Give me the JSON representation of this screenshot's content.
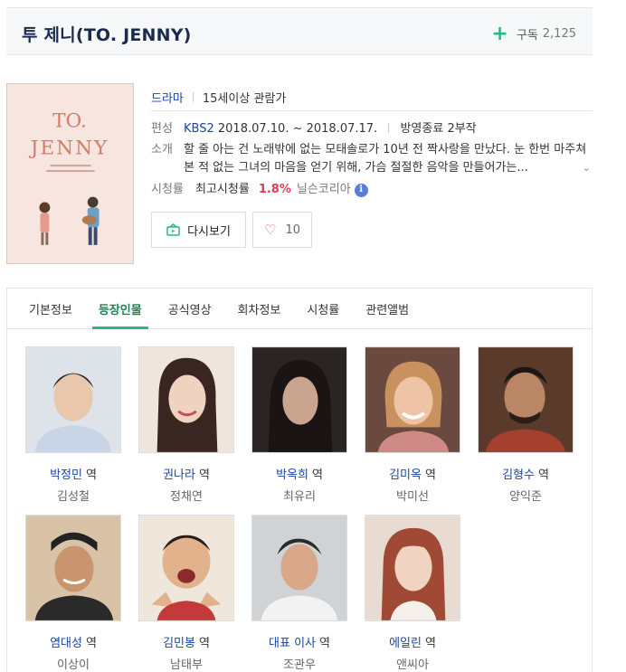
{
  "header": {
    "title": "투 제니(TO. JENNY)",
    "subscribe_label": "구독",
    "subscribe_count": "2,125"
  },
  "poster": {
    "title_line1": "TO.",
    "title_line2": "JENNY"
  },
  "info": {
    "genre": "드라마",
    "age_rating": "15세이상 관람가",
    "broadcast_label": "편성",
    "channel": "KBS2",
    "period": "2018.07.10. ~ 2018.07.17.",
    "status": "방영종료 2부작",
    "synopsis_label": "소개",
    "synopsis": "할 줄 아는 건 노래밖에 없는 모태솔로가 10년 전 짝사랑을 만났다. 눈 한번 마주쳐본 적 없는 그녀의 마음을 얻기 위해, 가슴 절절한 음악을 만들어가는...",
    "ratings_label": "시청률",
    "highest_label": "최고시청률",
    "highest_value": "1.8%",
    "ratings_source": "닐슨코리아"
  },
  "buttons": {
    "watch_label": "다시보기",
    "like_count": "10"
  },
  "tabs": [
    {
      "label": "기본정보"
    },
    {
      "label": "등장인물"
    },
    {
      "label": "공식영상"
    },
    {
      "label": "회차정보"
    },
    {
      "label": "시청률"
    },
    {
      "label": "관련앨범"
    }
  ],
  "active_tab": "등장인물",
  "role_suffix": "역",
  "cast": [
    {
      "role": "박정민",
      "actor": "김성철"
    },
    {
      "role": "권나라",
      "actor": "정채연"
    },
    {
      "role": "박옥희",
      "actor": "최유리"
    },
    {
      "role": "김미옥",
      "actor": "박미선"
    },
    {
      "role": "김형수",
      "actor": "양익준"
    },
    {
      "role": "염대성",
      "actor": "이상이"
    },
    {
      "role": "김민봉",
      "actor": "남태부"
    },
    {
      "role": "대표 이사",
      "actor": "조관우"
    },
    {
      "role": "에일린",
      "actor": "앤씨아"
    }
  ],
  "colors": {
    "accent_green": "#27b97e",
    "link_blue": "#1a45a6",
    "rating_red": "#e03c55"
  }
}
